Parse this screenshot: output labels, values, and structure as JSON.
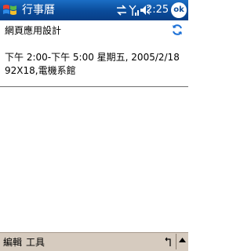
{
  "titlebar": {
    "app_title": "行事曆",
    "time": "2:25",
    "ok_label": "ok",
    "status_icons": [
      "sync-arrows-icon",
      "signal-strength-icon",
      "speaker-icon"
    ]
  },
  "appointment": {
    "subject": "網頁應用設計",
    "when": "下午 2:00-下午 5:00 星期五, 2005/2/18",
    "where": "92X18,電機系館"
  },
  "menubar": {
    "edit_label": "編輯",
    "tools_label": "工具",
    "undo_icon": "undo-icon",
    "sip_icon": "sip-arrow-icon"
  },
  "colors": {
    "titlebar": "#0a4b9a",
    "menubar": "#d6cbbf"
  }
}
